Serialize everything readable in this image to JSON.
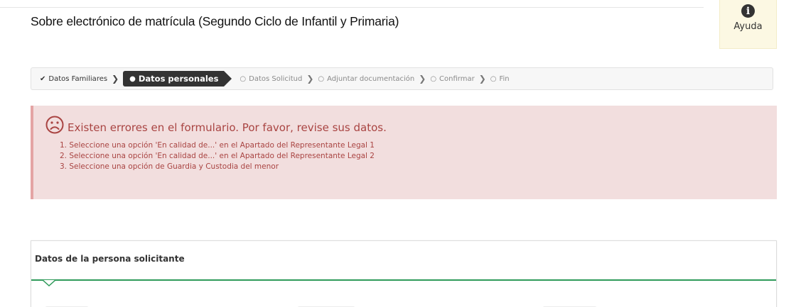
{
  "header": {
    "title": "Sobre electrónico de matrícula (Segundo Ciclo de Infantil y Primaria)",
    "help_label": "Ayuda",
    "help_icon": "info-icon"
  },
  "steps": [
    {
      "label": "Datos Familiares",
      "state": "done"
    },
    {
      "label": "Datos personales",
      "state": "active"
    },
    {
      "label": "Datos Solicitud",
      "state": "pending"
    },
    {
      "label": "Adjuntar documentación",
      "state": "pending"
    },
    {
      "label": "Confirmar",
      "state": "pending"
    },
    {
      "label": "Fin",
      "state": "pending"
    }
  ],
  "alert": {
    "icon": "sad-face-icon",
    "title": "Existen errores en el formulario. Por favor, revise sus datos.",
    "errors": [
      "1. Seleccione una opción 'En calidad de...' en el Apartado del Representante Legal 1",
      "2. Seleccione una opción 'En calidad de...' en el Apartado del Representante Legal 2",
      "3. Seleccione una opción de Guardia y Custodia del menor"
    ]
  },
  "panel": {
    "title": "Datos de la persona solicitante"
  },
  "colors": {
    "alert_bg": "#f2dede",
    "alert_text": "#a94442",
    "active_step": "#333333",
    "help_bg": "#fcf8e3",
    "panel_rule": "#2f9a5a"
  }
}
